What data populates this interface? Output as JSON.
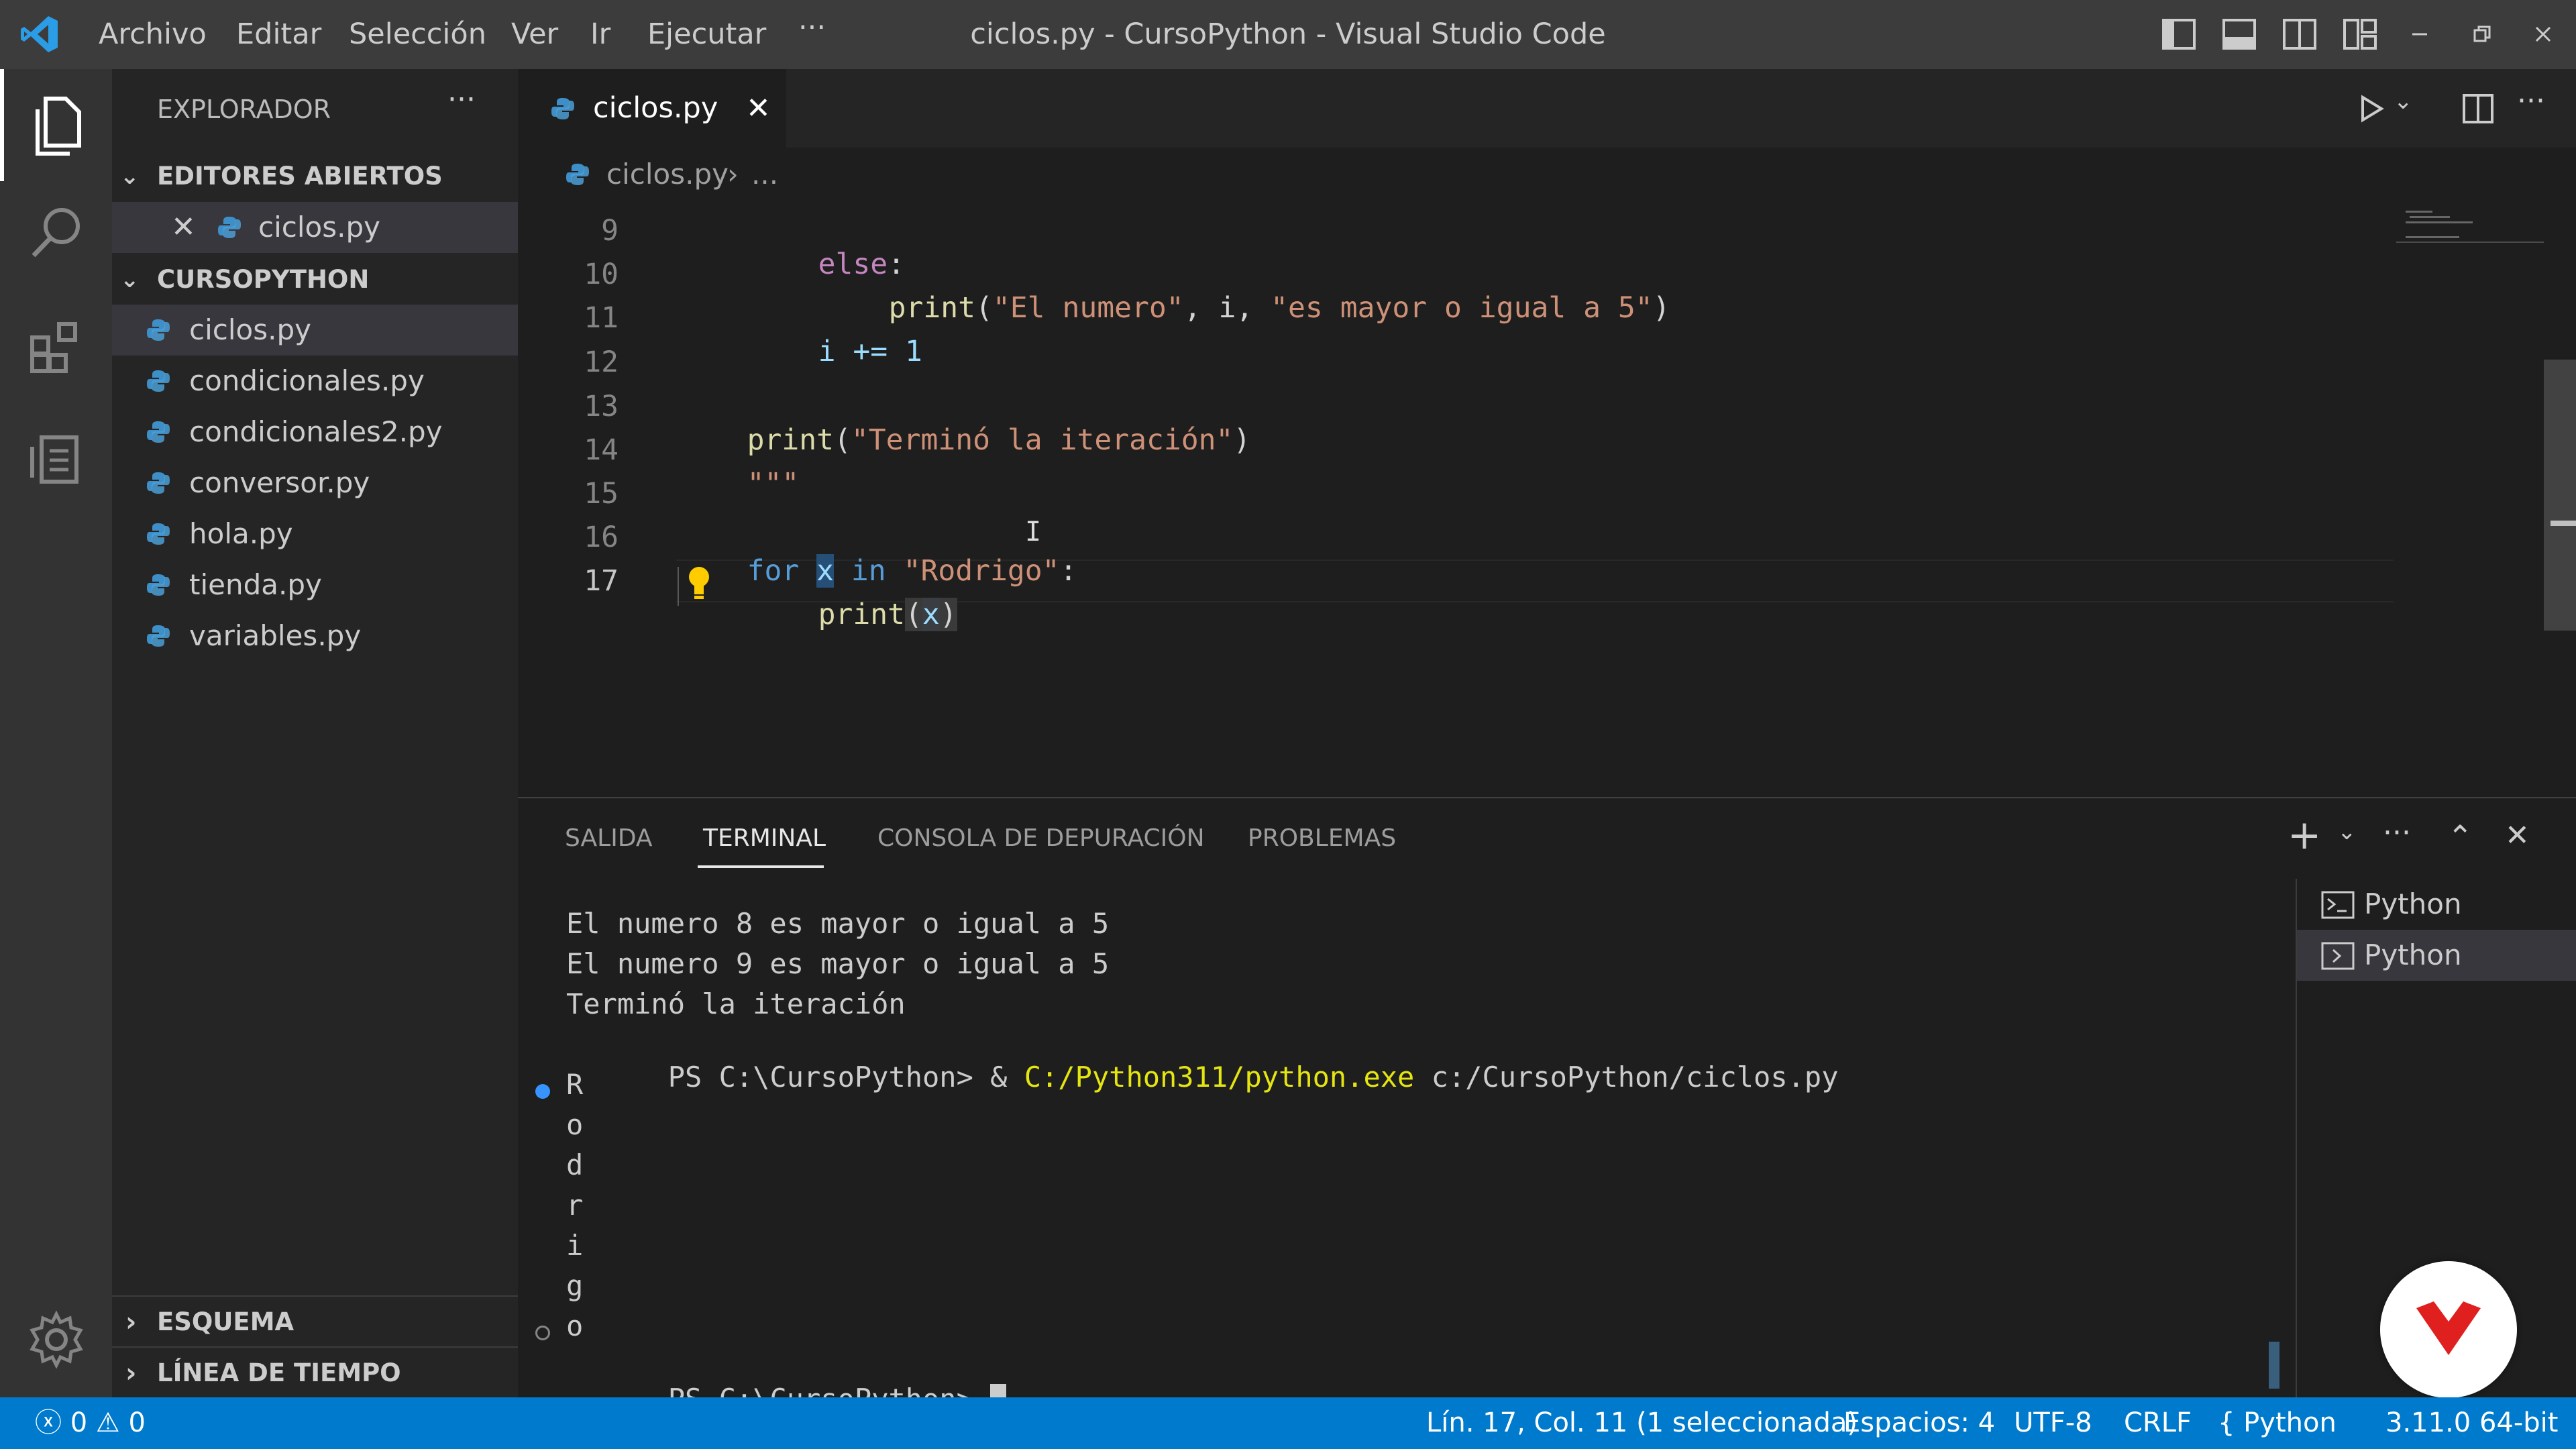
{
  "titlebar": {
    "menu": [
      "Archivo",
      "Editar",
      "Selección",
      "Ver",
      "Ir",
      "Ejecutar",
      "···"
    ],
    "title": "ciclos.py - CursoPython - Visual Studio Code"
  },
  "sidebar": {
    "header": "EXPLORADOR",
    "open_editors_label": "EDITORES ABIERTOS",
    "open_editors": [
      {
        "name": "ciclos.py"
      }
    ],
    "folder_label": "CURSOPYTHON",
    "files": [
      "ciclos.py",
      "condicionales.py",
      "condicionales2.py",
      "conversor.py",
      "hola.py",
      "tienda.py",
      "variables.py"
    ],
    "outline_label": "ESQUEMA",
    "timeline_label": "LÍNEA DE TIEMPO"
  },
  "editor": {
    "tab_label": "ciclos.py",
    "breadcrumb_file": "ciclos.py",
    "breadcrumb_rest": "...",
    "line_numbers": [
      "9",
      "10",
      "11",
      "12",
      "13",
      "14",
      "15",
      "16",
      "17"
    ],
    "code": {
      "l9_kw": "else",
      "l9_colon": ":",
      "l10_fn": "print",
      "l10_open": "(",
      "l10_s1": "\"El numero\"",
      "l10_mid": ", i, ",
      "l10_s2": "\"es mayor o igual a 5\"",
      "l10_close": ")",
      "l11": "i += 1",
      "l13_fn": "print",
      "l13_open": "(",
      "l13_s": "\"Terminó la iteración\"",
      "l13_close": ")",
      "l14": "\"\"\"",
      "l16_for": "for",
      "l16_x": "x",
      "l16_in": "in",
      "l16_s": "\"Rodrigo\"",
      "l16_colon": ":",
      "l17_fn": "print",
      "l17_open": "(",
      "l17_x": "x",
      "l17_close": ")"
    }
  },
  "panel": {
    "tabs": [
      "SALIDA",
      "TERMINAL",
      "CONSOLA DE DEPURACIÓN",
      "PROBLEMAS"
    ],
    "active_tab": "TERMINAL",
    "terminal": {
      "lines_before": [
        "El numero 8 es mayor o igual a 5",
        "El numero 9 es mayor o igual a 5",
        "Terminó la iteración"
      ],
      "prompt": "PS C:\\CursoPython> ",
      "cmd_amp": "& ",
      "cmd_exe": "C:/Python311/python.exe",
      "cmd_arg": " c:/CursoPython/ciclos.py",
      "output_chars": [
        "R",
        "o",
        "d",
        "r",
        "i",
        "g",
        "o"
      ]
    },
    "terminal_instances": [
      "Python",
      "Python"
    ]
  },
  "statusbar": {
    "errors": "0",
    "warnings": "0",
    "position": "Lín. 17, Col. 11 (1 seleccionada)",
    "spaces": "Espacios: 4",
    "encoding": "UTF-8",
    "eol": "CRLF",
    "language": "Python",
    "interpreter": "3.11.0 64-bit"
  },
  "colors": {
    "accent": "#007acc",
    "titlebar": "#3c3c3c",
    "sidebar": "#252526",
    "editor": "#1e1e1e",
    "keyword": "#569cd6",
    "string": "#ce9178",
    "brand_badge": "#e0201f"
  }
}
